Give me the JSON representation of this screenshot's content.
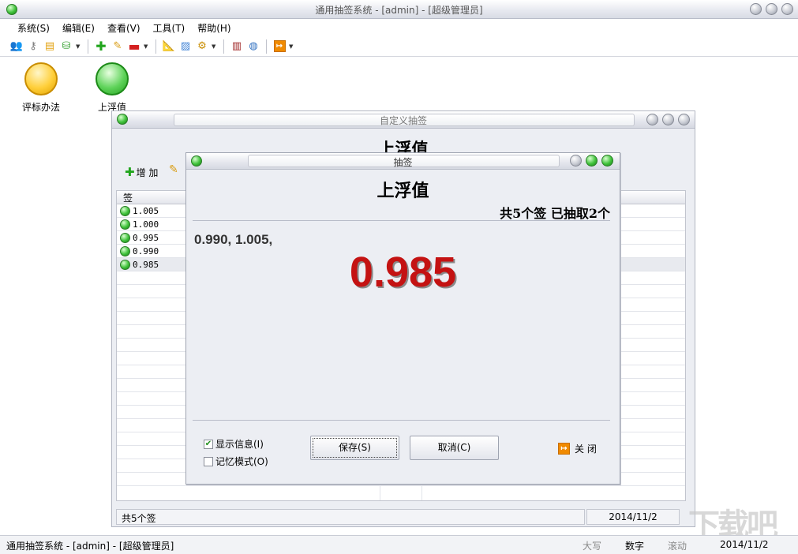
{
  "app": {
    "title": "通用抽签系统 - [admin] - [超级管理员]"
  },
  "menu": {
    "items": [
      "系统(S)",
      "编辑(E)",
      "查看(V)",
      "工具(T)",
      "帮助(H)"
    ]
  },
  "toolbar": {
    "icons": [
      "users-icon",
      "key-icon",
      "notepad-icon",
      "database-icon",
      "add-icon",
      "edit-icon",
      "remove-icon",
      "ruler-icon",
      "palette-icon",
      "gear-icon",
      "book-icon",
      "globe-icon",
      "exit-icon"
    ]
  },
  "desktop": {
    "icons": [
      {
        "label": "评标办法"
      },
      {
        "label": "上浮值"
      }
    ]
  },
  "child_window": {
    "title": "自定义抽签",
    "heading": "上浮值",
    "add_label": "增 加",
    "column_header": "签",
    "rows": [
      "1.005",
      "1.000",
      "0.995",
      "0.990",
      "0.985"
    ],
    "status_count": "共5个签",
    "status_date": "2014/11/2"
  },
  "dialog": {
    "title": "抽签",
    "heading": "上浮值",
    "count_text": "共5个签 已抽取2个",
    "drawn_text": "0.990, 1.005,",
    "result": "0.985",
    "show_info_label": "显示信息(I)",
    "memory_mode_label": "记忆模式(O)",
    "show_info_checked": true,
    "memory_mode_checked": false,
    "save_label": "保存(S)",
    "cancel_label": "取消(C)",
    "close_label": "关 闭"
  },
  "statusbar": {
    "text": "通用抽签系统 - [admin] - [超级管理员]",
    "caps": "大写",
    "num": "数字",
    "scroll": "滚动",
    "date": "2014/11/2"
  },
  "colors": {
    "result_red": "#c41212",
    "orb_green": "#3fc23a",
    "orb_yellow": "#ffcf3a",
    "close_orange": "#f08a00"
  }
}
